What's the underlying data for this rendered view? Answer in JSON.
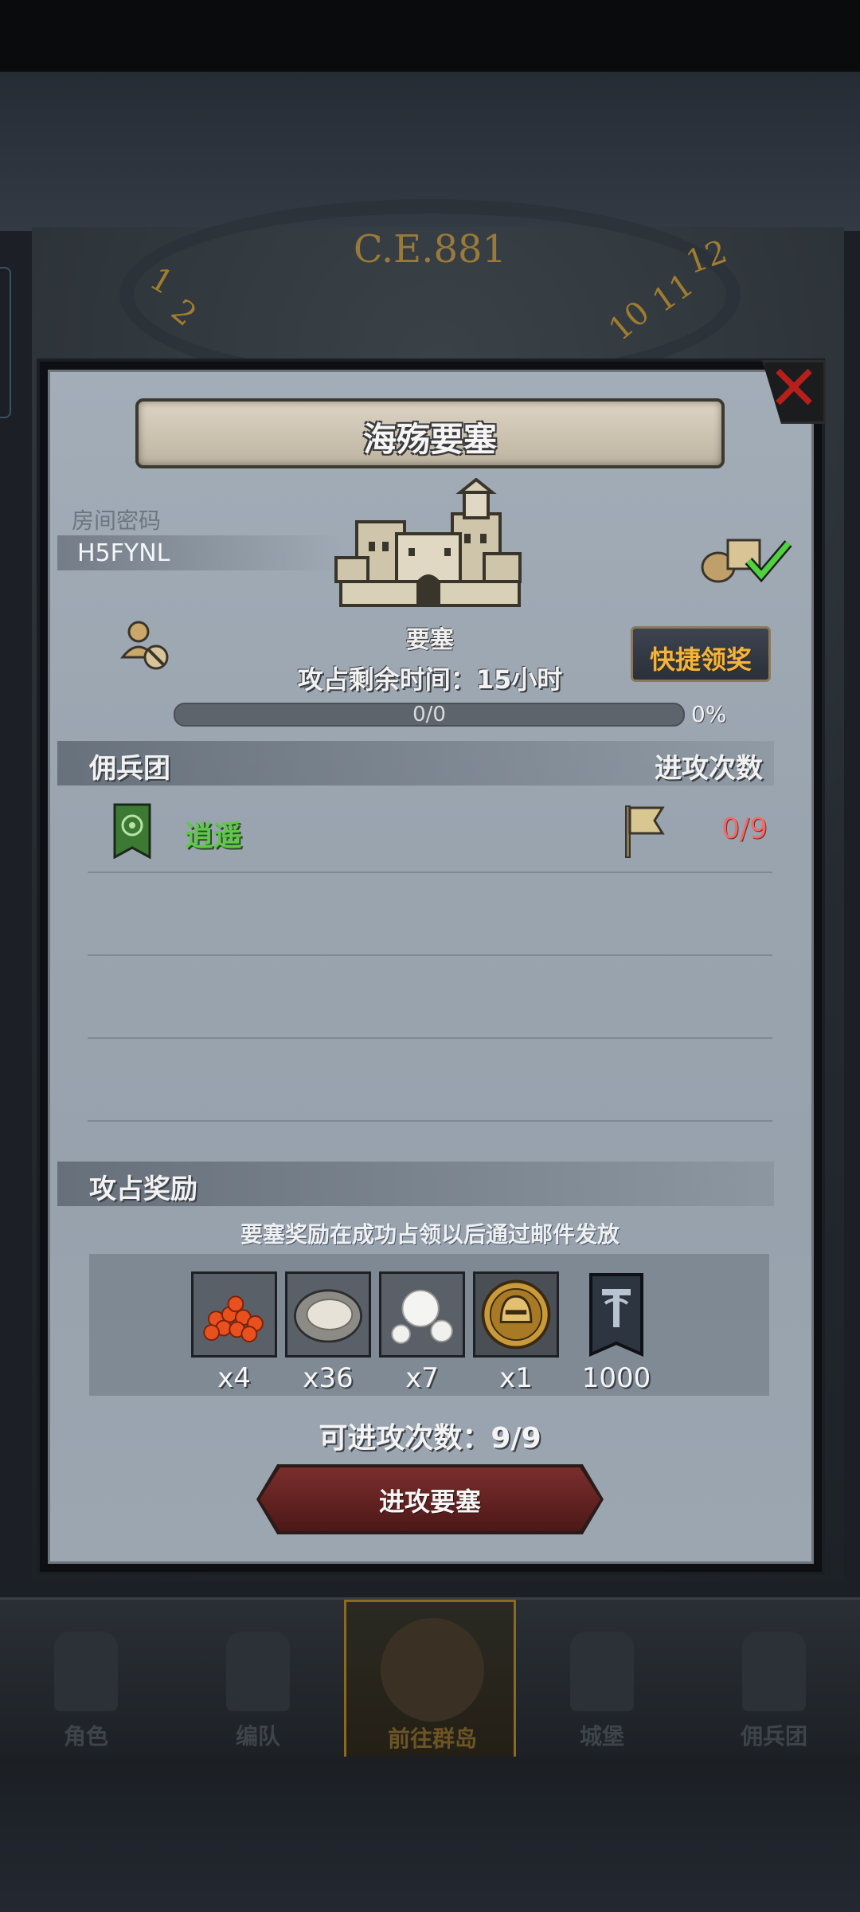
{
  "background": {
    "era_label": "C.E.881",
    "clock_numbers": [
      "12",
      "1",
      "2",
      "10",
      "11"
    ]
  },
  "modal": {
    "title": "海殇要塞",
    "room": {
      "label": "房间密码",
      "code": "H5FYNL"
    },
    "fortress": {
      "name": "要塞",
      "time_remaining": "攻占剩余时间：15小时",
      "progress_text": "0/0",
      "progress_percent": "0%",
      "progress_fraction": 0
    },
    "quick_claim_label": "快捷领奖",
    "mercenary_section": {
      "title": "佣兵团",
      "attack_count_header": "进攻次数",
      "rows": [
        {
          "name": "逍遥",
          "attack_count": "0/9",
          "name_color": "#5fc84a"
        }
      ]
    },
    "reward_section": {
      "title": "攻占奖励",
      "notice": "要塞奖励在成功占领以后通过邮件发放",
      "items": [
        {
          "icon": "fish-roe-icon",
          "qty": "x4"
        },
        {
          "icon": "oyster-icon",
          "qty": "x36"
        },
        {
          "icon": "pearl-icon",
          "qty": "x7"
        },
        {
          "icon": "gold-helmet-medal-icon",
          "qty": "x1"
        },
        {
          "icon": "guild-banner-icon",
          "qty": "1000"
        }
      ]
    },
    "remaining_attacks": "可进攻次数：9/9",
    "attack_button_label": "进攻要塞"
  },
  "bottom_nav": {
    "items": [
      {
        "label": "角色",
        "icon": "knight-icon"
      },
      {
        "label": "编队",
        "icon": "helmet-icon"
      },
      {
        "label": "前往群岛",
        "icon": "island-icon",
        "active": true
      },
      {
        "label": "城堡",
        "icon": "castle-icon"
      },
      {
        "label": "佣兵团",
        "icon": "ship-icon"
      }
    ]
  },
  "colors": {
    "accent_gold": "#f2b43c",
    "danger_red": "#b61f1a",
    "count_red": "#f06b68"
  }
}
